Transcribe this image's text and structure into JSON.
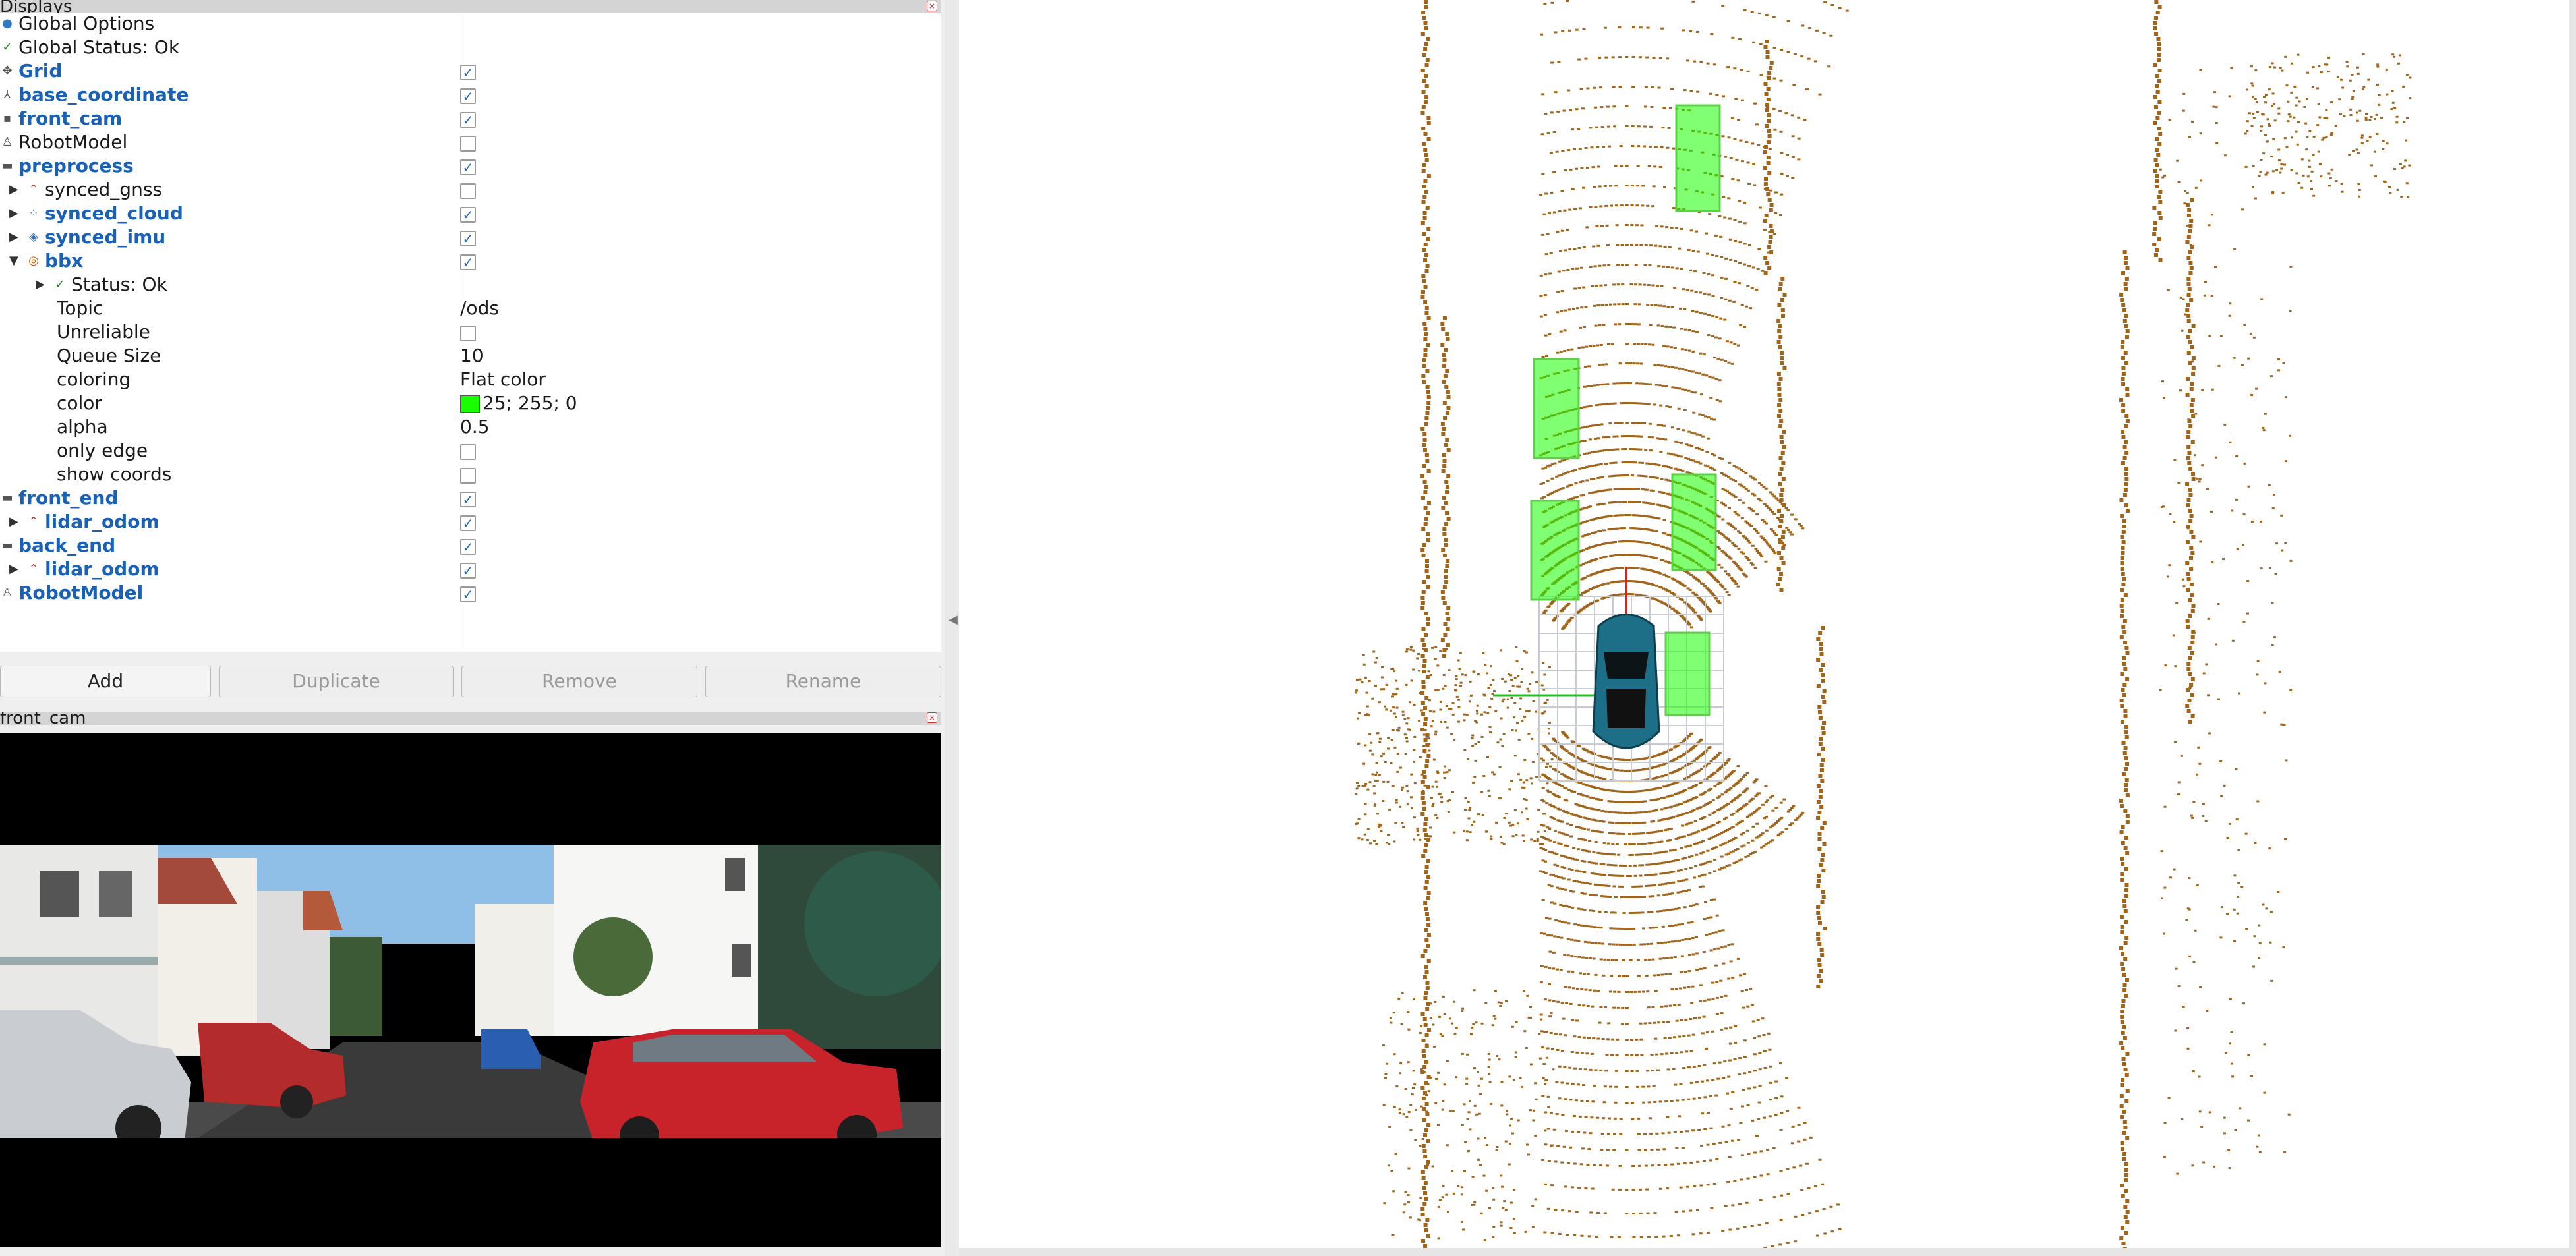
{
  "displays_panel": {
    "title": "Displays",
    "rows": [
      {
        "label": "Global Options",
        "icon": "globe-icon"
      },
      {
        "label": "Global Status: Ok",
        "icon": "check-icon"
      },
      {
        "label": "Grid",
        "icon": "grid-icon",
        "checked": true
      },
      {
        "label": "base_coordinate",
        "icon": "axes-icon",
        "checked": true
      },
      {
        "label": "front_cam",
        "icon": "camera-icon",
        "checked": true
      },
      {
        "label": "RobotModel",
        "icon": "robot-icon",
        "checked": false
      },
      {
        "label": "preprocess",
        "icon": "folder-icon",
        "checked": true
      },
      {
        "label": "synced_gnss",
        "icon": "path-icon",
        "checked": false
      },
      {
        "label": "synced_cloud",
        "icon": "pointcloud-icon",
        "checked": true
      },
      {
        "label": "synced_imu",
        "icon": "imu-icon",
        "checked": true
      },
      {
        "label": "bbx",
        "icon": "bbox-icon",
        "checked": true
      },
      {
        "label": "Status: Ok",
        "icon": "check-icon"
      },
      {
        "label": "Topic",
        "value": "/ods"
      },
      {
        "label": "Unreliable",
        "checked": false
      },
      {
        "label": "Queue Size",
        "value": "10"
      },
      {
        "label": "coloring",
        "value": "Flat color"
      },
      {
        "label": "color",
        "value": "25; 255; 0",
        "swatch_color": "#19ff00"
      },
      {
        "label": "alpha",
        "value": "0.5"
      },
      {
        "label": "only edge",
        "checked": false
      },
      {
        "label": "show coords",
        "checked": false
      },
      {
        "label": "front_end",
        "icon": "folder-icon",
        "checked": true
      },
      {
        "label": "lidar_odom",
        "icon": "path-icon",
        "checked": true
      },
      {
        "label": "back_end",
        "icon": "folder-icon",
        "checked": true
      },
      {
        "label": "lidar_odom",
        "icon": "path-icon",
        "checked": true
      },
      {
        "label": "RobotModel",
        "icon": "robot-icon",
        "checked": true
      }
    ],
    "buttons": {
      "add": "Add",
      "duplicate": "Duplicate",
      "remove": "Remove",
      "rename": "Rename"
    }
  },
  "camera_panel": {
    "title": "front_cam"
  },
  "colors": {
    "accent": "#1a60b4",
    "bbox_green": "#19ff00",
    "pointcloud": "#a0651a",
    "car_body": "#1c6f86"
  }
}
